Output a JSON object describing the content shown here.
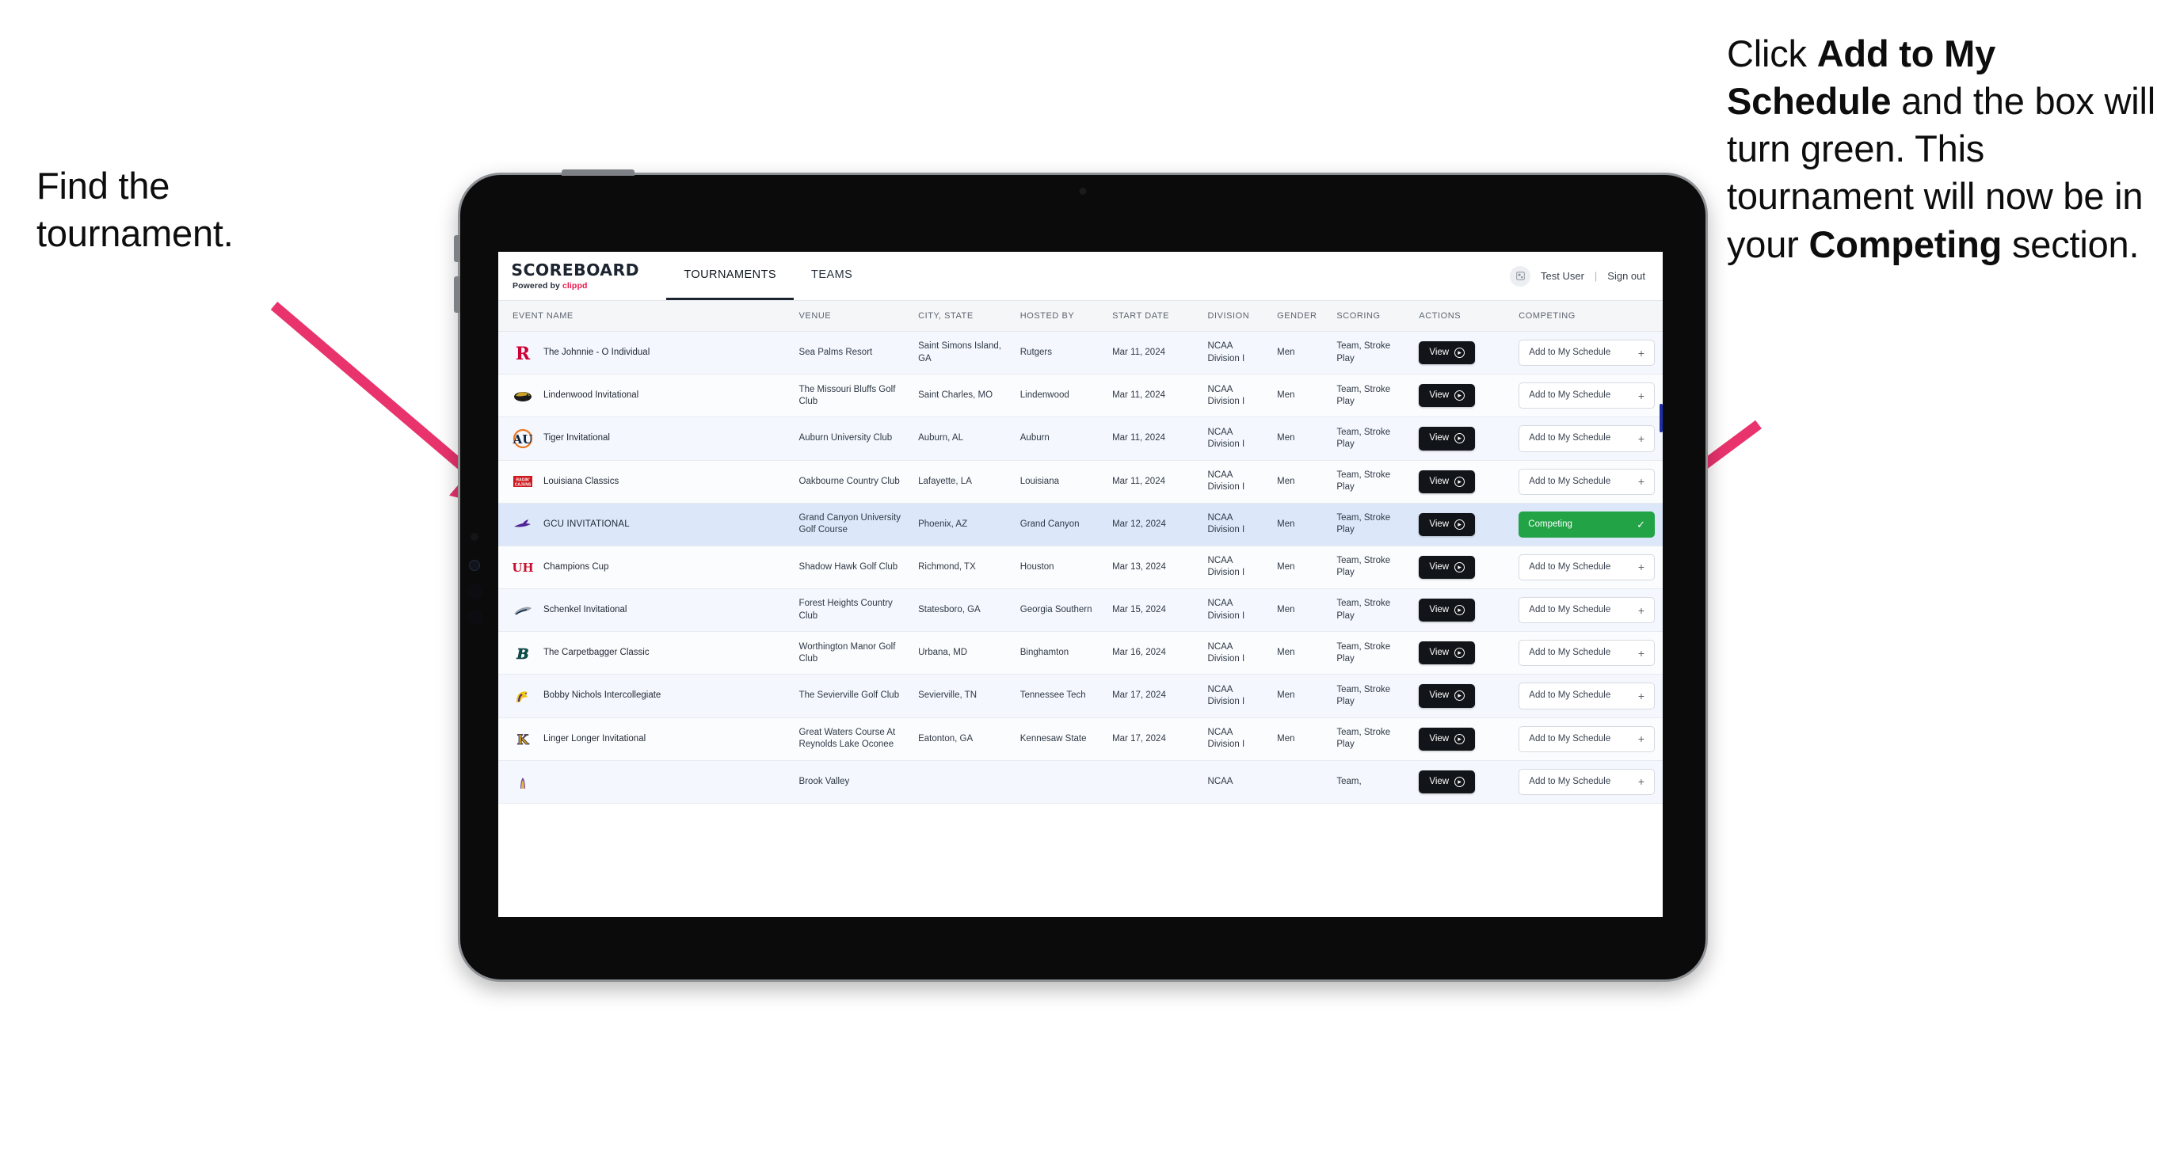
{
  "annotations": {
    "left": {
      "lines": [
        "Find the",
        "tournament."
      ]
    },
    "right": {
      "segments": [
        {
          "t": "Click ",
          "b": false
        },
        {
          "t": "Add to My Schedule",
          "b": true
        },
        {
          "t": " and the box will turn green. This tournament will now be in your ",
          "b": false
        },
        {
          "t": "Competing",
          "b": true
        },
        {
          "t": " section.",
          "b": false
        }
      ]
    },
    "arrow_color": "#e8336d"
  },
  "app": {
    "brand": {
      "title": "SCOREBOARD",
      "powered_prefix": "Powered by ",
      "powered_name": "clippd"
    },
    "nav": [
      {
        "label": "TOURNAMENTS",
        "active": true
      },
      {
        "label": "TEAMS",
        "active": false
      }
    ],
    "header_right": {
      "avatar_icon": "user-avatar-icon",
      "user": "Test User",
      "separator": "|",
      "signout": "Sign out"
    }
  },
  "table": {
    "columns": [
      "EVENT NAME",
      "VENUE",
      "CITY, STATE",
      "HOSTED BY",
      "START DATE",
      "DIVISION",
      "GENDER",
      "SCORING",
      "ACTIONS",
      "COMPETING"
    ],
    "view_label": "View",
    "add_label": "Add to My Schedule",
    "add_plus": "+",
    "competing_label": "Competing",
    "competing_check": "✓",
    "rows": [
      {
        "logo": "rutgers-logo",
        "logo_kind": "rutgers",
        "event": "The Johnnie - O Individual",
        "venue": "Sea Palms Resort",
        "city": "Saint Simons Island, GA",
        "hosted_by": "Rutgers",
        "start_date": "Mar 11, 2024",
        "division": "NCAA Division I",
        "gender": "Men",
        "scoring": "Team, Stroke Play",
        "competing": false
      },
      {
        "logo": "lindenwood-logo",
        "logo_kind": "lindenwood",
        "event": "Lindenwood Invitational",
        "venue": "The Missouri Bluffs Golf Club",
        "city": "Saint Charles, MO",
        "hosted_by": "Lindenwood",
        "start_date": "Mar 11, 2024",
        "division": "NCAA Division I",
        "gender": "Men",
        "scoring": "Team, Stroke Play",
        "competing": false
      },
      {
        "logo": "auburn-logo",
        "logo_kind": "auburn",
        "event": "Tiger Invitational",
        "venue": "Auburn University Club",
        "city": "Auburn, AL",
        "hosted_by": "Auburn",
        "start_date": "Mar 11, 2024",
        "division": "NCAA Division I",
        "gender": "Men",
        "scoring": "Team, Stroke Play",
        "competing": false
      },
      {
        "logo": "louisiana-logo",
        "logo_kind": "louisiana",
        "event": "Louisiana Classics",
        "venue": "Oakbourne Country Club",
        "city": "Lafayette, LA",
        "hosted_by": "Louisiana",
        "start_date": "Mar 11, 2024",
        "division": "NCAA Division I",
        "gender": "Men",
        "scoring": "Team, Stroke Play",
        "competing": false
      },
      {
        "logo": "gcu-logo",
        "logo_kind": "gcu",
        "event": "GCU INVITATIONAL",
        "venue": "Grand Canyon University Golf Course",
        "city": "Phoenix, AZ",
        "hosted_by": "Grand Canyon",
        "start_date": "Mar 12, 2024",
        "division": "NCAA Division I",
        "gender": "Men",
        "scoring": "Team, Stroke Play",
        "competing": true,
        "selected": true
      },
      {
        "logo": "houston-logo",
        "logo_kind": "houston",
        "event": "Champions Cup",
        "venue": "Shadow Hawk Golf Club",
        "city": "Richmond, TX",
        "hosted_by": "Houston",
        "start_date": "Mar 13, 2024",
        "division": "NCAA Division I",
        "gender": "Men",
        "scoring": "Team, Stroke Play",
        "competing": false
      },
      {
        "logo": "georgia-southern-logo",
        "logo_kind": "gasouthern",
        "event": "Schenkel Invitational",
        "venue": "Forest Heights Country Club",
        "city": "Statesboro, GA",
        "hosted_by": "Georgia Southern",
        "start_date": "Mar 15, 2024",
        "division": "NCAA Division I",
        "gender": "Men",
        "scoring": "Team, Stroke Play",
        "competing": false
      },
      {
        "logo": "binghamton-logo",
        "logo_kind": "binghamton",
        "event": "The Carpetbagger Classic",
        "venue": "Worthington Manor Golf Club",
        "city": "Urbana, MD",
        "hosted_by": "Binghamton",
        "start_date": "Mar 16, 2024",
        "division": "NCAA Division I",
        "gender": "Men",
        "scoring": "Team, Stroke Play",
        "competing": false
      },
      {
        "logo": "tennessee-tech-logo",
        "logo_kind": "tntech",
        "event": "Bobby Nichols Intercollegiate",
        "venue": "The Sevierville Golf Club",
        "city": "Sevierville, TN",
        "hosted_by": "Tennessee Tech",
        "start_date": "Mar 17, 2024",
        "division": "NCAA Division I",
        "gender": "Men",
        "scoring": "Team, Stroke Play",
        "competing": false
      },
      {
        "logo": "kennesaw-state-logo",
        "logo_kind": "kennesaw",
        "event": "Linger Longer Invitational",
        "venue": "Great Waters Course At Reynolds Lake Oconee",
        "city": "Eatonton, GA",
        "hosted_by": "Kennesaw State",
        "start_date": "Mar 17, 2024",
        "division": "NCAA Division I",
        "gender": "Men",
        "scoring": "Team, Stroke Play",
        "competing": false
      },
      {
        "logo": "partial-logo",
        "logo_kind": "partial",
        "event": "",
        "venue": "Brook Valley",
        "city": "",
        "hosted_by": "",
        "start_date": "",
        "division": "NCAA",
        "gender": "",
        "scoring": "Team,",
        "competing": false,
        "partial": true
      }
    ]
  },
  "colors": {
    "accent_green": "#22a346",
    "accent_pink": "#e8336d",
    "brand_red": "#e8174a",
    "row_selected": "#dce8fa",
    "dark_button": "#111418"
  }
}
